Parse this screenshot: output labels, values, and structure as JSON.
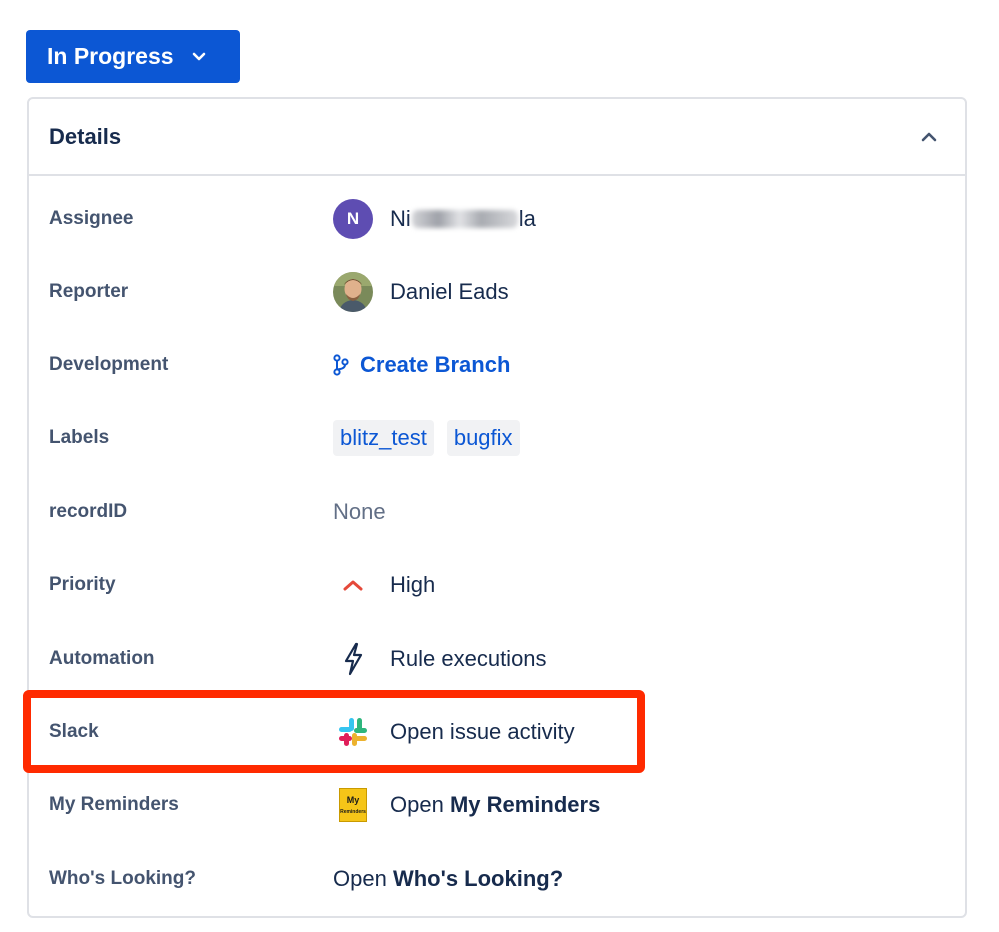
{
  "status_button": {
    "label": "In Progress"
  },
  "details": {
    "title": "Details",
    "assignee": {
      "label": "Assignee",
      "initial": "N",
      "name_start": "Ni",
      "name_end": "la"
    },
    "reporter": {
      "label": "Reporter",
      "name": "Daniel Eads"
    },
    "development": {
      "label": "Development",
      "action": "Create Branch"
    },
    "labels": {
      "label": "Labels",
      "items": [
        "blitz_test",
        "bugfix"
      ]
    },
    "record_id": {
      "label": "recordID",
      "value": "None"
    },
    "priority": {
      "label": "Priority",
      "value": "High"
    },
    "automation": {
      "label": "Automation",
      "value": "Rule executions"
    },
    "slack": {
      "label": "Slack",
      "value": "Open issue activity"
    },
    "my_reminders": {
      "label": "My Reminders",
      "prefix": "Open",
      "name": "My Reminders",
      "icon_top": "My",
      "icon_bottom": "Reminders"
    },
    "whos_looking": {
      "label": "Who's Looking?",
      "prefix": "Open",
      "name": "Who's Looking?"
    }
  },
  "colors": {
    "primary": "#0c57d4",
    "priority_high": "#e5493a",
    "highlight": "#ff2a00"
  }
}
